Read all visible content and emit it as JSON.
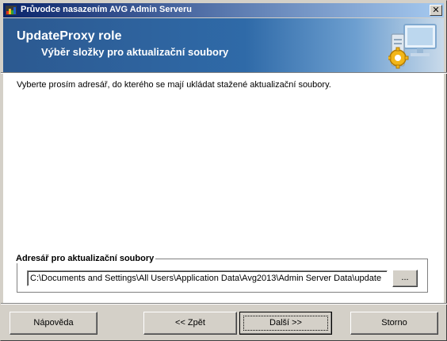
{
  "window": {
    "title": "Průvodce nasazením AVG Admin Serveru"
  },
  "titlebar": {
    "close_label": "✕",
    "icons": {
      "app": "avg-app-icon",
      "close": "close-icon"
    }
  },
  "header": {
    "title": "UpdateProxy role",
    "subtitle": "Výběr složky pro aktualizační soubory",
    "icon": "server-gear-monitor-icon"
  },
  "content": {
    "instruction": "Vyberte prosím adresář, do kterého se mají ukládat stažené aktualizační soubory.",
    "folder_group": {
      "legend": "Adresář pro aktualizační soubory",
      "path_value": "C:\\Documents and Settings\\All Users\\Application Data\\Avg2013\\Admin Server Data\\update",
      "browse_label": "..."
    }
  },
  "footer": {
    "help_label": "Nápověda",
    "back_label": "<< Zpět",
    "next_label": "Další >>",
    "cancel_label": "Storno"
  },
  "colors": {
    "titlebar_start": "#0a246a",
    "titlebar_end": "#a6caf0",
    "header_blue": "#2f6aa8",
    "dialog_face": "#d4d0c8"
  }
}
